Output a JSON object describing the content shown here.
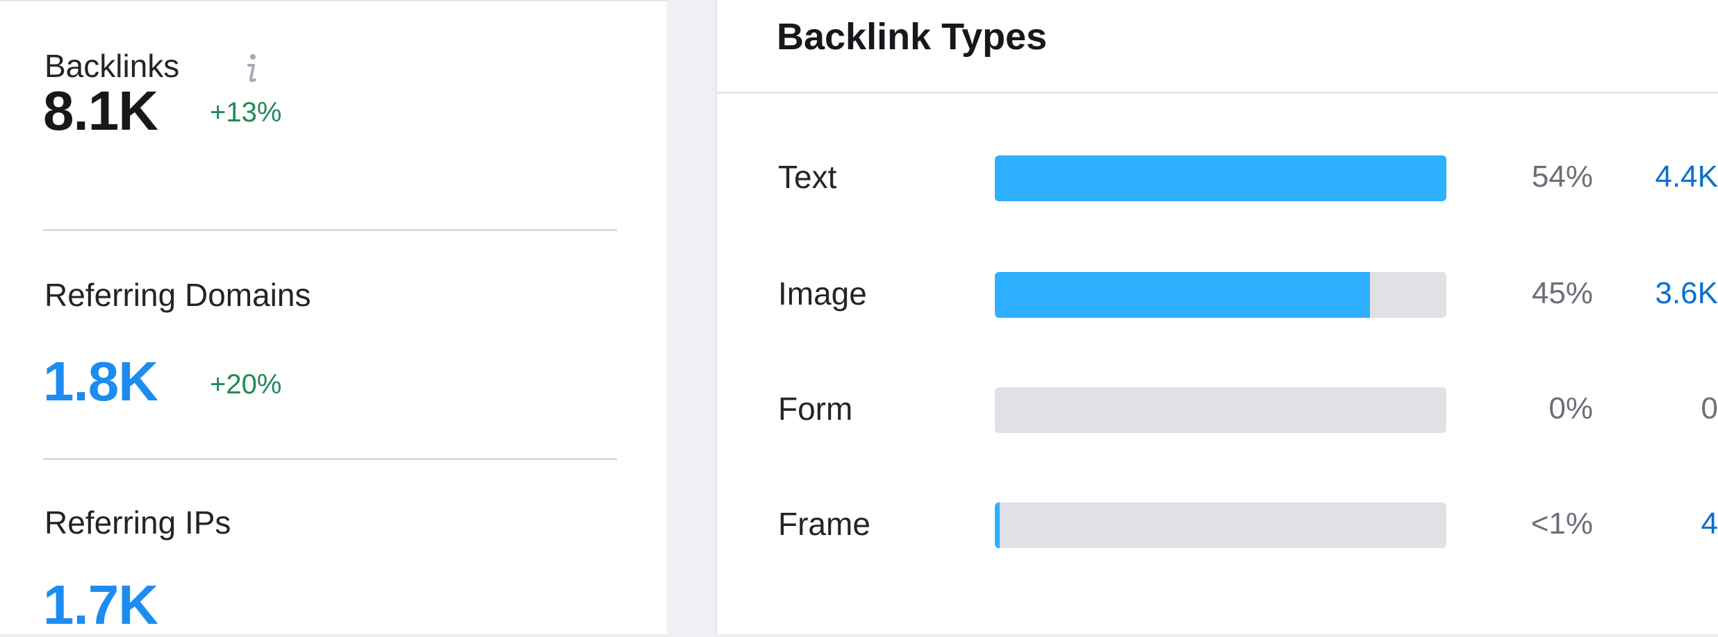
{
  "metrics": {
    "backlinks": {
      "label": "Backlinks",
      "value": "8.1K",
      "change": "+13%"
    },
    "referring_domains": {
      "label": "Referring Domains",
      "value": "1.8K",
      "change": "+20%"
    },
    "referring_ips": {
      "label": "Referring IPs",
      "value": "1.7K"
    }
  },
  "backlink_types": {
    "title": "Backlink Types",
    "rows": [
      {
        "label": "Text",
        "percent": "54%",
        "count": "4.4K",
        "fill_fraction": 1.0
      },
      {
        "label": "Image",
        "percent": "45%",
        "count": "3.6K",
        "fill_fraction": 0.83
      },
      {
        "label": "Form",
        "percent": "0%",
        "count": "0",
        "fill_fraction": 0.0
      },
      {
        "label": "Frame",
        "percent": "<1%",
        "count": "4",
        "fill_fraction": 0.01
      }
    ]
  },
  "icons": {
    "info": "info-icon"
  },
  "colors": {
    "accent_blue": "#1c8cf0",
    "bar_fill": "#2cb0ff",
    "bar_track": "#dfe1e6",
    "positive_change": "#1f8a57",
    "link_count": "#0b6fcf"
  }
}
